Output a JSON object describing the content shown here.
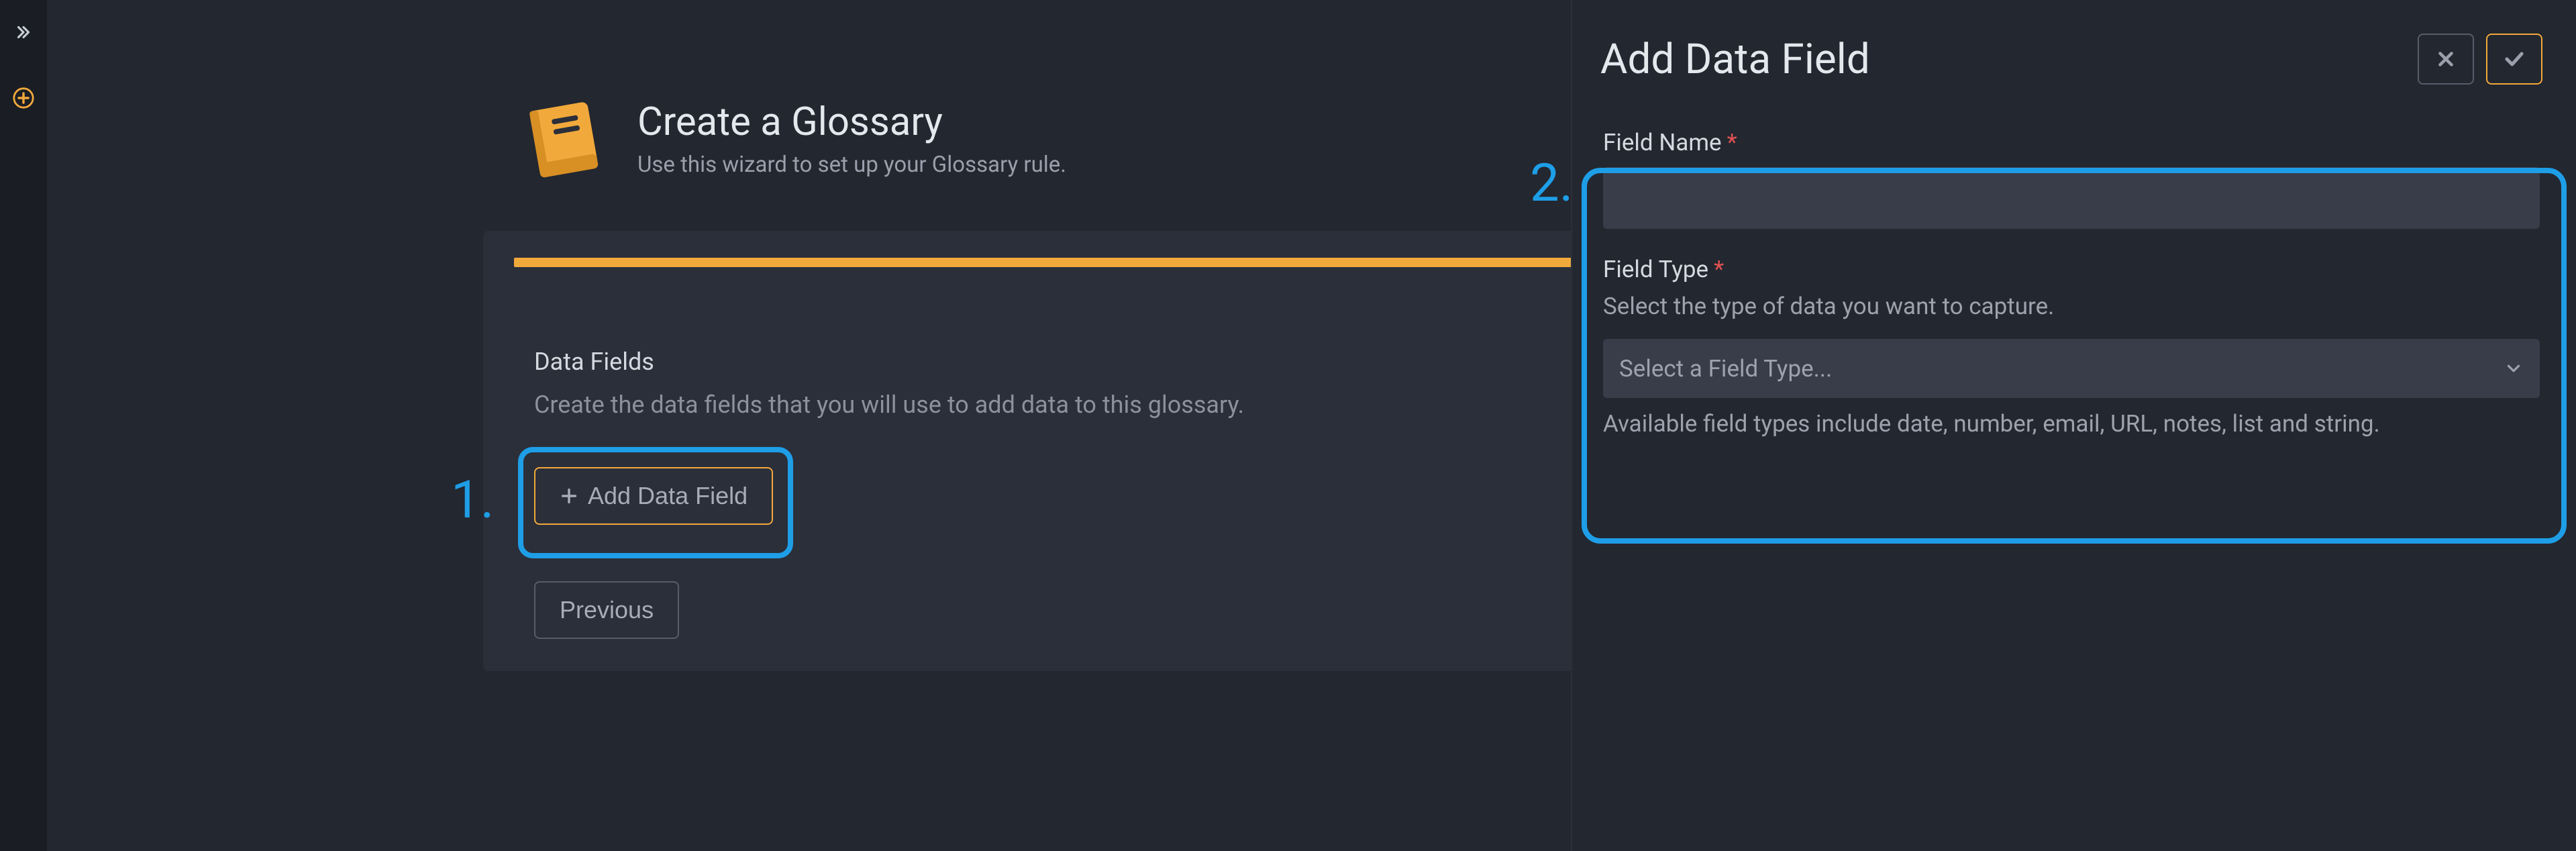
{
  "sidebar": {
    "expand_label": "Expand sidebar",
    "add_label": "Add"
  },
  "wizard": {
    "title": "Create a Glossary",
    "subtitle": "Use this wizard to set up your Glossary rule.",
    "section_title": "Data Fields",
    "section_desc": "Create the data fields that you will use to add data to this glossary.",
    "add_btn": "Add Data Field",
    "prev_btn": "Previous"
  },
  "callouts": {
    "one": "1.",
    "two": "2."
  },
  "panel": {
    "title": "Add Data Field",
    "field_name_label": "Field Name",
    "field_name_value": "",
    "field_type_label": "Field Type",
    "field_type_help": "Select the type of data you want to capture.",
    "field_type_placeholder": "Select a Field Type...",
    "field_type_hint": "Available field types include date, number, email, URL, notes, list and string.",
    "required_marker": "*"
  }
}
